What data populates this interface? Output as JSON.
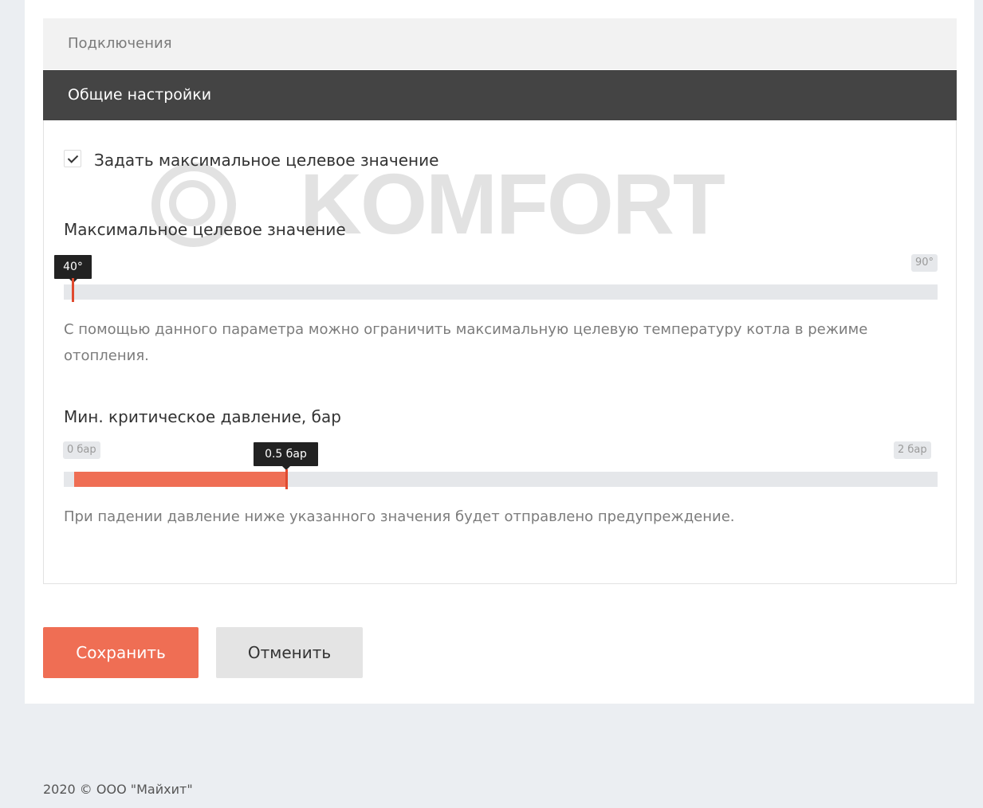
{
  "tabs": {
    "connections_label": "Подключения",
    "general_label": "Общие настройки"
  },
  "watermark": {
    "text": "KOMFORT"
  },
  "settings": {
    "max_target_checkbox": {
      "label": "Задать максимальное целевое значение",
      "checked": true
    },
    "max_target_slider": {
      "label": "Максимальное целевое значение",
      "value_label": "40°",
      "max_label": "90°",
      "value": 40,
      "max": 90,
      "description": "С помощью данного параметра можно ограничить максимальную целевую температуру котла в режиме отопления."
    },
    "min_pressure_slider": {
      "label": "Мин. критическое давление, бар",
      "value_label": "0.5 бар",
      "min_label": "0 бар",
      "max_label": "2 бар",
      "value": 0.5,
      "min": 0,
      "max": 2,
      "description": "При падении давление ниже указанного значения будет отправлено предупреждение."
    }
  },
  "actions": {
    "save_label": "Сохранить",
    "cancel_label": "Отменить"
  },
  "footer": {
    "copyright": "2020 © ООО \"Майхит\""
  },
  "colors": {
    "accent": "#ef6e54",
    "active_tab": "#444444",
    "background": "#ebeef2"
  }
}
